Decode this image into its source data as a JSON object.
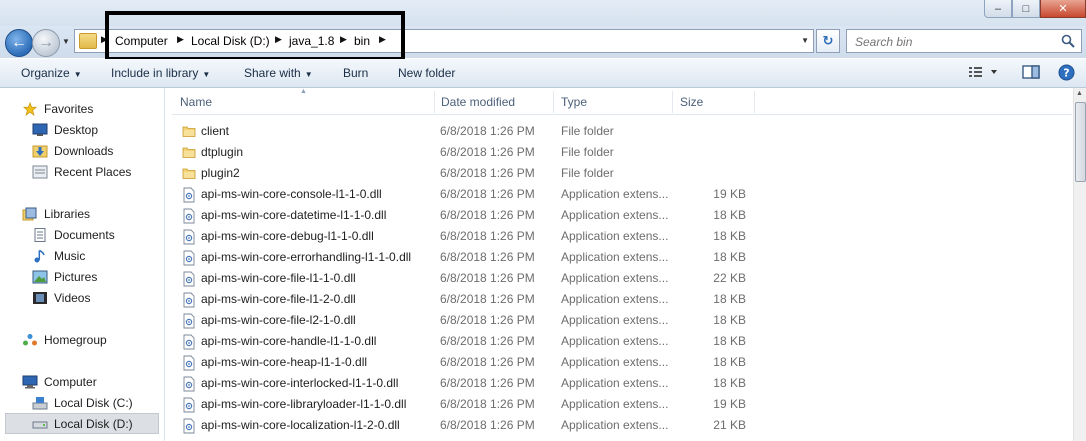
{
  "address": {
    "crumbs": [
      "Computer",
      "Local Disk (D:)",
      "java_1.8",
      "bin"
    ]
  },
  "search": {
    "placeholder": "Search bin"
  },
  "toolbar": {
    "organize": "Organize",
    "include_in_library": "Include in library",
    "share_with": "Share with",
    "burn": "Burn",
    "new_folder": "New folder"
  },
  "columns": {
    "name": "Name",
    "date": "Date modified",
    "type": "Type",
    "size": "Size"
  },
  "sidebar": {
    "favorites": "Favorites",
    "desktop": "Desktop",
    "downloads": "Downloads",
    "recent_places": "Recent Places",
    "libraries": "Libraries",
    "documents": "Documents",
    "music": "Music",
    "pictures": "Pictures",
    "videos": "Videos",
    "homegroup": "Homegroup",
    "computer": "Computer",
    "local_c": "Local Disk (C:)",
    "local_d": "Local Disk (D:)"
  },
  "files": [
    {
      "name": "client",
      "date": "6/8/2018 1:26 PM",
      "type": "File folder",
      "size": "",
      "kind": "folder"
    },
    {
      "name": "dtplugin",
      "date": "6/8/2018 1:26 PM",
      "type": "File folder",
      "size": "",
      "kind": "folder"
    },
    {
      "name": "plugin2",
      "date": "6/8/2018 1:26 PM",
      "type": "File folder",
      "size": "",
      "kind": "folder"
    },
    {
      "name": "api-ms-win-core-console-l1-1-0.dll",
      "date": "6/8/2018 1:26 PM",
      "type": "Application extens...",
      "size": "19 KB",
      "kind": "dll"
    },
    {
      "name": "api-ms-win-core-datetime-l1-1-0.dll",
      "date": "6/8/2018 1:26 PM",
      "type": "Application extens...",
      "size": "18 KB",
      "kind": "dll"
    },
    {
      "name": "api-ms-win-core-debug-l1-1-0.dll",
      "date": "6/8/2018 1:26 PM",
      "type": "Application extens...",
      "size": "18 KB",
      "kind": "dll"
    },
    {
      "name": "api-ms-win-core-errorhandling-l1-1-0.dll",
      "date": "6/8/2018 1:26 PM",
      "type": "Application extens...",
      "size": "18 KB",
      "kind": "dll"
    },
    {
      "name": "api-ms-win-core-file-l1-1-0.dll",
      "date": "6/8/2018 1:26 PM",
      "type": "Application extens...",
      "size": "22 KB",
      "kind": "dll"
    },
    {
      "name": "api-ms-win-core-file-l1-2-0.dll",
      "date": "6/8/2018 1:26 PM",
      "type": "Application extens...",
      "size": "18 KB",
      "kind": "dll"
    },
    {
      "name": "api-ms-win-core-file-l2-1-0.dll",
      "date": "6/8/2018 1:26 PM",
      "type": "Application extens...",
      "size": "18 KB",
      "kind": "dll"
    },
    {
      "name": "api-ms-win-core-handle-l1-1-0.dll",
      "date": "6/8/2018 1:26 PM",
      "type": "Application extens...",
      "size": "18 KB",
      "kind": "dll"
    },
    {
      "name": "api-ms-win-core-heap-l1-1-0.dll",
      "date": "6/8/2018 1:26 PM",
      "type": "Application extens...",
      "size": "18 KB",
      "kind": "dll"
    },
    {
      "name": "api-ms-win-core-interlocked-l1-1-0.dll",
      "date": "6/8/2018 1:26 PM",
      "type": "Application extens...",
      "size": "18 KB",
      "kind": "dll"
    },
    {
      "name": "api-ms-win-core-libraryloader-l1-1-0.dll",
      "date": "6/8/2018 1:26 PM",
      "type": "Application extens...",
      "size": "19 KB",
      "kind": "dll"
    },
    {
      "name": "api-ms-win-core-localization-l1-2-0.dll",
      "date": "6/8/2018 1:26 PM",
      "type": "Application extens...",
      "size": "21 KB",
      "kind": "dll"
    }
  ],
  "colors": {
    "highlight_box": "#000000",
    "selected_nav": "#dcdfe4",
    "header_text": "#4c607a"
  }
}
